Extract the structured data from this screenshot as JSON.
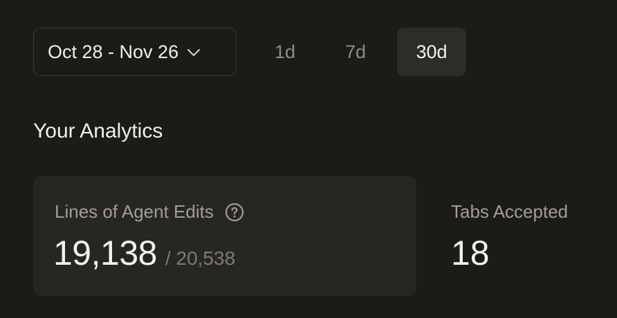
{
  "date_range": {
    "label": "Oct 28 - Nov 26"
  },
  "presets": [
    {
      "label": "1d",
      "active": false
    },
    {
      "label": "7d",
      "active": false
    },
    {
      "label": "30d",
      "active": true
    }
  ],
  "section_title": "Your Analytics",
  "metrics": {
    "agent_edits": {
      "label": "Lines of Agent Edits",
      "value": "19,138",
      "total": "/ 20,538",
      "help_icon": "question-circle-icon"
    },
    "tabs_accepted": {
      "label": "Tabs Accepted",
      "value": "18"
    }
  },
  "colors": {
    "background": "#1c1b17",
    "card": "#272622",
    "active_preset": "#2d2c28",
    "text_primary": "#f1efe9",
    "text_muted": "#a19e96",
    "text_faint": "#7d7a73"
  }
}
